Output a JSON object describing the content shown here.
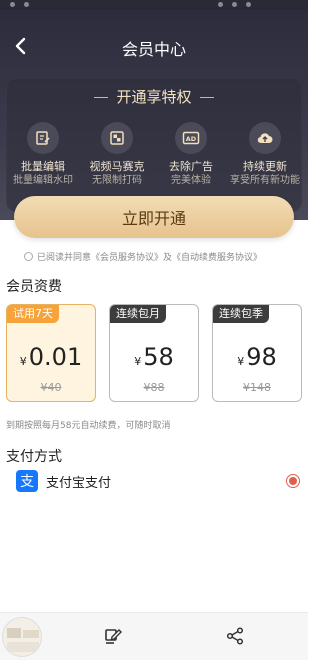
{
  "nav": {
    "title": "会员中心",
    "back_icon": "chevron-left-icon"
  },
  "privileges": {
    "title": "开通享特权",
    "items": [
      {
        "icon": "batch-edit-icon",
        "title": "批量编辑",
        "subtitle": "批量编辑水印"
      },
      {
        "icon": "mosaic-icon",
        "title": "视频马赛克",
        "subtitle": "无限制打码"
      },
      {
        "icon": "ad-icon",
        "title": "去除广告",
        "subtitle": "完美体验"
      },
      {
        "icon": "cloud-upload-icon",
        "title": "持续更新",
        "subtitle": "享受所有新功能"
      }
    ]
  },
  "cta": {
    "label": "立即开通"
  },
  "agreement": {
    "prefix": "已阅读并同意",
    "link1": "《会员服务协议》",
    "and": "及",
    "link2": "《自动续费服务协议》"
  },
  "fees": {
    "title": "会员资费",
    "plans": [
      {
        "tag": "试用7天",
        "currency": "¥",
        "price": "0.01",
        "original": "¥40",
        "selected": true
      },
      {
        "tag": "连续包月",
        "currency": "¥",
        "price": "58",
        "original": "¥88",
        "selected": false
      },
      {
        "tag": "连续包季",
        "currency": "¥",
        "price": "98",
        "original": "¥148",
        "selected": false
      }
    ],
    "note": "到期按照每月58元自动续费，可随时取消"
  },
  "payment": {
    "title": "支付方式",
    "method_label": "支付宝支付",
    "method_icon": "alipay-icon"
  },
  "bottom_bar": {
    "left_icon": "edit-icon",
    "right_icon": "share-icon"
  },
  "colors": {
    "header_bg": "#2b2b3a",
    "gold_text": "#f3e2c1",
    "cta_bg": "#e9c896",
    "selected_tag": "#f5a33a",
    "selected_bg": "#fff4df",
    "radio_red": "#e0614b",
    "alipay_blue": "#1677ff"
  }
}
